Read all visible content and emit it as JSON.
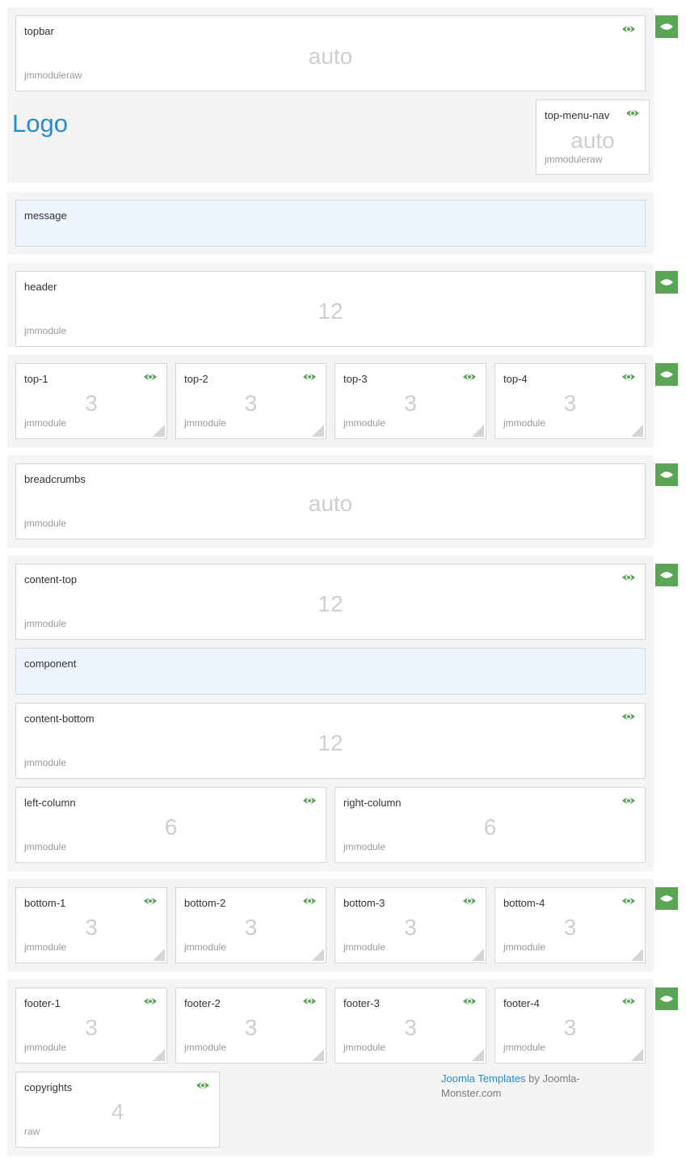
{
  "colors": {
    "accent": "#5ba654",
    "link": "#2a8ad0",
    "section_bg": "#f4f4f4",
    "message_bg": "#edf4fd"
  },
  "icons": {
    "visibility": "eye-icon",
    "resize": "resize-handle-icon"
  },
  "logo": "Logo",
  "modules": {
    "topbar": {
      "name": "topbar",
      "size": "auto",
      "type": "jmmoduleraw"
    },
    "top_menu_nav": {
      "name": "top-menu-nav",
      "size": "auto",
      "type": "jmmoduleraw"
    },
    "message": {
      "name": "message"
    },
    "header": {
      "name": "header",
      "size": "12",
      "type": "jmmodule"
    },
    "top": [
      {
        "name": "top-1",
        "size": "3",
        "type": "jmmodule"
      },
      {
        "name": "top-2",
        "size": "3",
        "type": "jmmodule"
      },
      {
        "name": "top-3",
        "size": "3",
        "type": "jmmodule"
      },
      {
        "name": "top-4",
        "size": "3",
        "type": "jmmodule"
      }
    ],
    "breadcrumbs": {
      "name": "breadcrumbs",
      "size": "auto",
      "type": "jmmodule"
    },
    "content_top": {
      "name": "content-top",
      "size": "12",
      "type": "jmmodule"
    },
    "component": {
      "name": "component"
    },
    "content_bottom": {
      "name": "content-bottom",
      "size": "12",
      "type": "jmmodule"
    },
    "left_column": {
      "name": "left-column",
      "size": "6",
      "type": "jmmodule"
    },
    "right_column": {
      "name": "right-column",
      "size": "6",
      "type": "jmmodule"
    },
    "bottom": [
      {
        "name": "bottom-1",
        "size": "3",
        "type": "jmmodule"
      },
      {
        "name": "bottom-2",
        "size": "3",
        "type": "jmmodule"
      },
      {
        "name": "bottom-3",
        "size": "3",
        "type": "jmmodule"
      },
      {
        "name": "bottom-4",
        "size": "3",
        "type": "jmmodule"
      }
    ],
    "footer": [
      {
        "name": "footer-1",
        "size": "3",
        "type": "jmmodule"
      },
      {
        "name": "footer-2",
        "size": "3",
        "type": "jmmodule"
      },
      {
        "name": "footer-3",
        "size": "3",
        "type": "jmmodule"
      },
      {
        "name": "footer-4",
        "size": "3",
        "type": "jmmodule"
      }
    ],
    "copyrights": {
      "name": "copyrights",
      "size": "4",
      "type": "raw"
    }
  },
  "credits": {
    "link_text": "Joomla Templates",
    "rest": " by Joomla-Monster.com"
  }
}
